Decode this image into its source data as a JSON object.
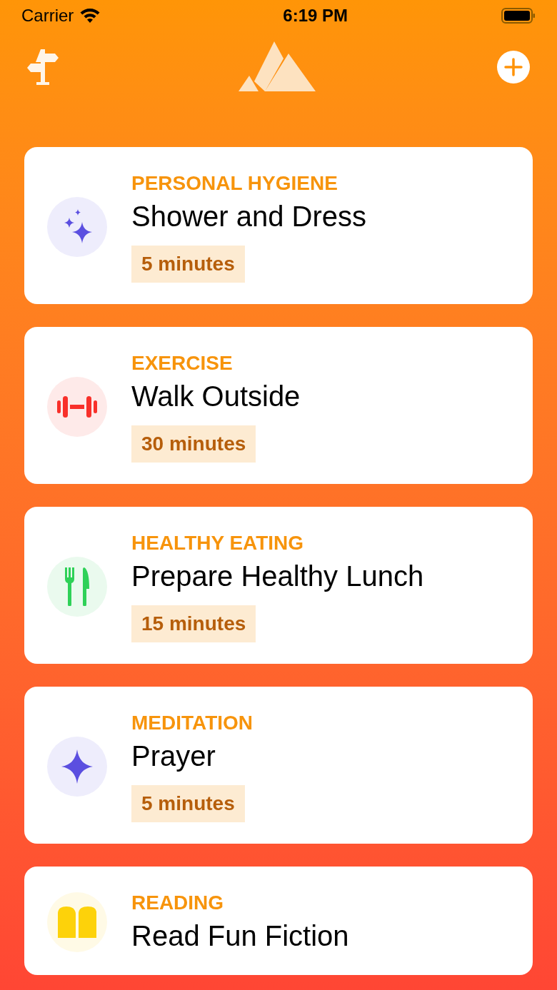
{
  "status_bar": {
    "carrier": "Carrier",
    "time": "6:19 PM"
  },
  "habits": [
    {
      "category": "PERSONAL HYGIENE",
      "title": "Shower and Dress",
      "duration": "5 minutes",
      "kind": "sparkles",
      "color": "#5b4fe0"
    },
    {
      "category": "EXERCISE",
      "title": "Walk Outside",
      "duration": "30 minutes",
      "kind": "dumbbell",
      "color": "#f8302a"
    },
    {
      "category": "HEALTHY EATING",
      "title": "Prepare Healthy Lunch",
      "duration": "15 minutes",
      "kind": "cutlery",
      "color": "#2fd158"
    },
    {
      "category": "MEDITATION",
      "title": "Prayer",
      "duration": "5 minutes",
      "kind": "sparkle",
      "color": "#5b4fe0"
    },
    {
      "category": "READING",
      "title": "Read Fun Fiction",
      "kind": "book",
      "color": "#fdd20a"
    }
  ]
}
